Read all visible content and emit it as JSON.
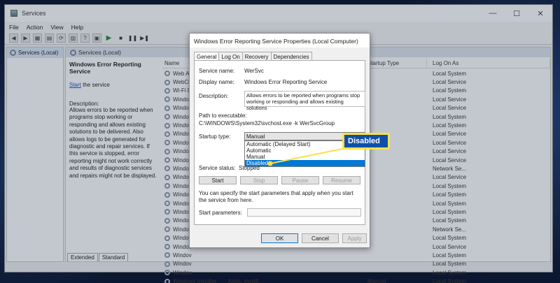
{
  "window": {
    "title": "Services",
    "controls": [
      "—",
      "☐",
      "✕"
    ]
  },
  "menu": [
    "File",
    "Action",
    "View",
    "Help"
  ],
  "tree": {
    "root": "Services (Local)"
  },
  "main": {
    "header": "Services (Local)",
    "description_pane": {
      "title": "Windows Error Reporting Service",
      "start_link": "Start",
      "start_suffix": " the service",
      "desc_label": "Description:",
      "desc_text": "Allows errors to be reported when programs stop working or responding and allows existing solutions to be delivered. Also allows logs to be generated for diagnostic and repair services. If this service is stopped, error reporting might not work correctly and results of diagnostic services and repairs might not be displayed."
    },
    "columns": {
      "name": "Name",
      "startup": "Startup Type",
      "logon": "Log On As"
    },
    "rows": [
      {
        "name": "Web Ac",
        "startup": "",
        "logon": "Local System"
      },
      {
        "name": "WebCli",
        "startup": "",
        "logon": "Local Service"
      },
      {
        "name": "Wi-Fi D",
        "startup": "",
        "logon": "Local System"
      },
      {
        "name": "Windov",
        "startup": "",
        "logon": "Local Service"
      },
      {
        "name": "Windov",
        "startup": "",
        "logon": "Local Service"
      },
      {
        "name": "Windov",
        "startup": "",
        "logon": "Local System"
      },
      {
        "name": "Windov",
        "startup": "",
        "logon": "Local System"
      },
      {
        "name": "Windov",
        "startup": "",
        "logon": "Local Service"
      },
      {
        "name": "Windov",
        "startup": "",
        "logon": "Local Service"
      },
      {
        "name": "Windov",
        "startup": "",
        "logon": "Local Service"
      },
      {
        "name": "Windov",
        "startup": "",
        "logon": "Local Service"
      },
      {
        "name": "Windov",
        "startup": "",
        "logon": "Network Se..."
      },
      {
        "name": "Windov",
        "startup": "",
        "logon": "Local Service"
      },
      {
        "name": "Windov",
        "startup": "",
        "logon": "Local System"
      },
      {
        "name": "Windov",
        "startup": "",
        "logon": "Local System"
      },
      {
        "name": "Windov",
        "startup": "",
        "logon": "Local System"
      },
      {
        "name": "Windov",
        "startup": "",
        "logon": "Local System"
      },
      {
        "name": "Windov",
        "startup": "",
        "logon": "Local System"
      },
      {
        "name": "Windov",
        "startup": "",
        "logon": "Network Se..."
      },
      {
        "name": "Windov",
        "startup": "",
        "logon": "Local System"
      },
      {
        "name": "Windov",
        "startup": "",
        "logon": "Local Service"
      },
      {
        "name": "Windov",
        "startup": "",
        "logon": "Local System"
      },
      {
        "name": "Windov",
        "startup": "",
        "logon": "Local System"
      },
      {
        "name": "Windov",
        "startup": "",
        "logon": "Local System"
      },
      {
        "name": "Windows Installer",
        "status": "Adds, modifi...",
        "startup": "Manual",
        "logon": "Local System"
      }
    ],
    "tabs": [
      "Extended",
      "Standard"
    ]
  },
  "dialog": {
    "title": "Windows Error Reporting Service Properties (Local Computer)",
    "tabs": [
      "General",
      "Log On",
      "Recovery",
      "Dependencies"
    ],
    "service_name_label": "Service name:",
    "service_name": "WerSvc",
    "display_name_label": "Display name:",
    "display_name": "Windows Error Reporting Service",
    "description_label": "Description:",
    "description": "Allows errors to be reported when programs stop working or responding and allows existing solutions",
    "path_label": "Path to executable:",
    "path": "C:\\WINDOWS\\System32\\svchost.exe -k WerSvcGroup",
    "startup_type_label": "Startup type:",
    "startup_type": "Manual",
    "startup_options": [
      "Automatic (Delayed Start)",
      "Automatic",
      "Manual",
      "Disabled"
    ],
    "service_status_label": "Service status:",
    "service_status": "Stopped",
    "buttons": {
      "start": "Start",
      "stop": "Stop",
      "pause": "Pause",
      "resume": "Resume"
    },
    "params_hint": "You can specify the start parameters that apply when you start the service from here.",
    "params_label": "Start parameters:",
    "ok": "OK",
    "cancel": "Cancel",
    "apply": "Apply"
  },
  "callout": {
    "label": "Disabled",
    "color": "#fde047",
    "fill": "#0f4fa8"
  }
}
